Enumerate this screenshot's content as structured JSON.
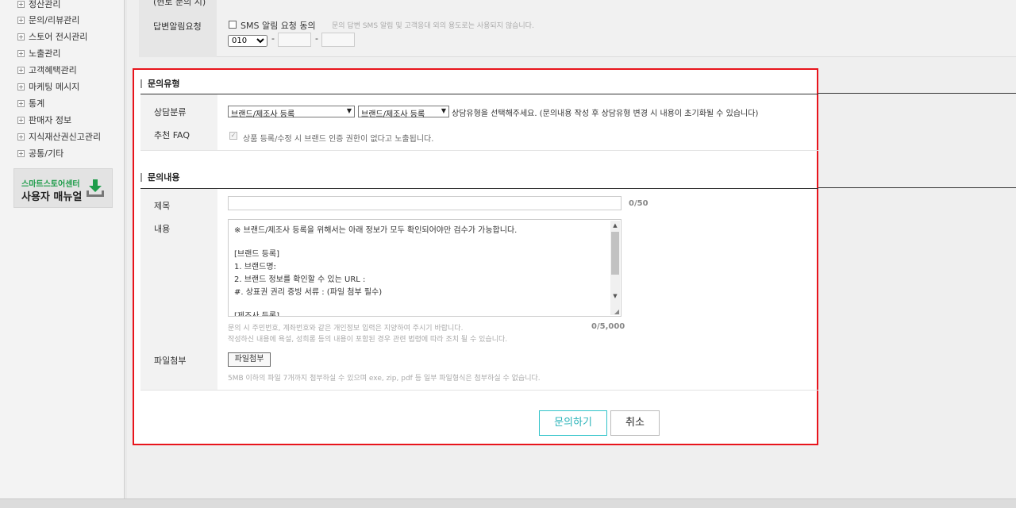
{
  "sidebar": {
    "items": [
      {
        "label": "정산관리"
      },
      {
        "label": "문의/리뷰관리"
      },
      {
        "label": "스토어 전시관리"
      },
      {
        "label": "노출관리"
      },
      {
        "label": "고객혜택관리"
      },
      {
        "label": "마케팅 메시지"
      },
      {
        "label": "통계"
      },
      {
        "label": "판매자 정보"
      },
      {
        "label": "지식재산권신고관리"
      },
      {
        "label": "공통/기타"
      }
    ],
    "manual": {
      "line1": "스마트스토어센터",
      "line2": "사용자 매뉴얼",
      "icon": "download-icon"
    }
  },
  "background": {
    "cut_text": "(현로 문의 시)",
    "sms_label": "답변알림요청",
    "sms_checkbox_label": "SMS 알림 요청 동의",
    "sms_note": "문의 답변 SMS 알림 및 고객응대 외의 용도로는 사용되지 않습니다.",
    "phone_prefix": "010"
  },
  "form": {
    "inquiry_type_title": "문의유형",
    "category_label": "상담분류",
    "category_select_1": "브랜드/제조사 등록",
    "category_select_2": "브랜드/제조사 등록",
    "category_guide": "상담유형을 선택해주세요. (문의내용 작성 후 상담유형 변경 시 내용이 초기화될 수 있습니다)",
    "faq_label": "추천 FAQ",
    "faq_text": "상품 등록/수정 시 브랜드 인증 권한이 없다고 노출됩니다.",
    "inquiry_content_title": "문의내용",
    "title_label": "제목",
    "title_value": "",
    "title_count": "0/50",
    "content_label": "내용",
    "content_lines": [
      "※ 브랜드/제조사 등록을 위해서는 아래 정보가 모두 확인되어야만 검수가 가능합니다.",
      "",
      "[브랜드 등록]",
      "1. 브랜드명:",
      "2. 브랜드 정보를 확인할 수 있는 URL :",
      "#. 상표권 권리 증빙 서류 : (파일 첨부 필수)",
      "",
      "[제조사 등록]"
    ],
    "content_hint_1": "문의 시 주민번호, 계좌번호와 같은 개인정보 입력은 지양하여 주시기 바랍니다.",
    "content_hint_2": "작성하신 내용에 욕설, 성희롱 등의 내용이 포함된 경우 관련 법령에 따라 조치 될 수 있습니다.",
    "content_count": "0/5,000",
    "file_label": "파일첨부",
    "file_button": "파일첨부",
    "file_hint": "5MB 이하의 파일 7개까지 첨부하실 수 있으며 exe, zip, pdf 등 일부 파일형식은 첨부하실 수 없습니다.",
    "submit_label": "문의하기",
    "cancel_label": "취소"
  },
  "colors": {
    "highlight_border": "#e8141c",
    "submit_accent": "#2bb3b9",
    "manual_green": "#1e9c4a"
  }
}
